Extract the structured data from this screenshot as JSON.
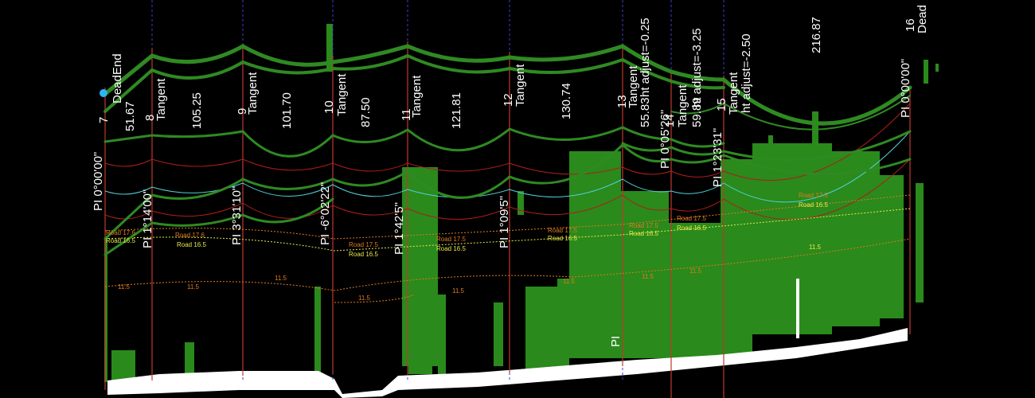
{
  "colors": {
    "background": "#000000",
    "conductor": "#2f8a22",
    "vegetation": "#2a8a1c",
    "ground": "#ffffff",
    "structure_line": "#c0392b",
    "guide_blue": "#3b3bd6",
    "clearance_red": "#b01d1d",
    "clearance_cyan": "#4fd0d8",
    "road_orange": "#e07a1f",
    "road_yellow": "#e8e84a"
  },
  "structures": [
    {
      "number": "7",
      "type": "DeadEnd",
      "pi": "PI 0°00'00\""
    },
    {
      "number": "8",
      "type": "Tangent",
      "pi": "PI 1°14'00\""
    },
    {
      "number": "9",
      "type": "Tangent",
      "pi": "PI 3°31'10\""
    },
    {
      "number": "10",
      "type": "Tangent",
      "pi": "PI -6°02'22\""
    },
    {
      "number": "11",
      "type": "Tangent",
      "pi": "PI 1°42'5\""
    },
    {
      "number": "12",
      "type": "Tangent",
      "pi": "PI 1°09'5\""
    },
    {
      "number": "13",
      "type": "Tangent",
      "pi": "PI 0°05'26\"",
      "extra": "ht adjust=-0.25"
    },
    {
      "number": "14",
      "type": "Tangent",
      "pi": "",
      "extra": "ht adjust=-3.25"
    },
    {
      "number": "15",
      "type": "Tangent",
      "pi": "PI 1°23'31\"",
      "extra": "ht adjust=-2.50"
    },
    {
      "number": "16",
      "type": "Dead",
      "pi": "PI 0°00'00\""
    }
  ],
  "spans": [
    "51.67",
    "105.25",
    "101.70",
    "87.50",
    "121.81",
    "130.74",
    "55.83",
    "59.89",
    "216.87"
  ],
  "road_labels": {
    "r17": "Road 17.5",
    "r16": "Road 16.5",
    "r17b": "Road 17.6",
    "c115": "11.5"
  },
  "partial_text": "PI"
}
